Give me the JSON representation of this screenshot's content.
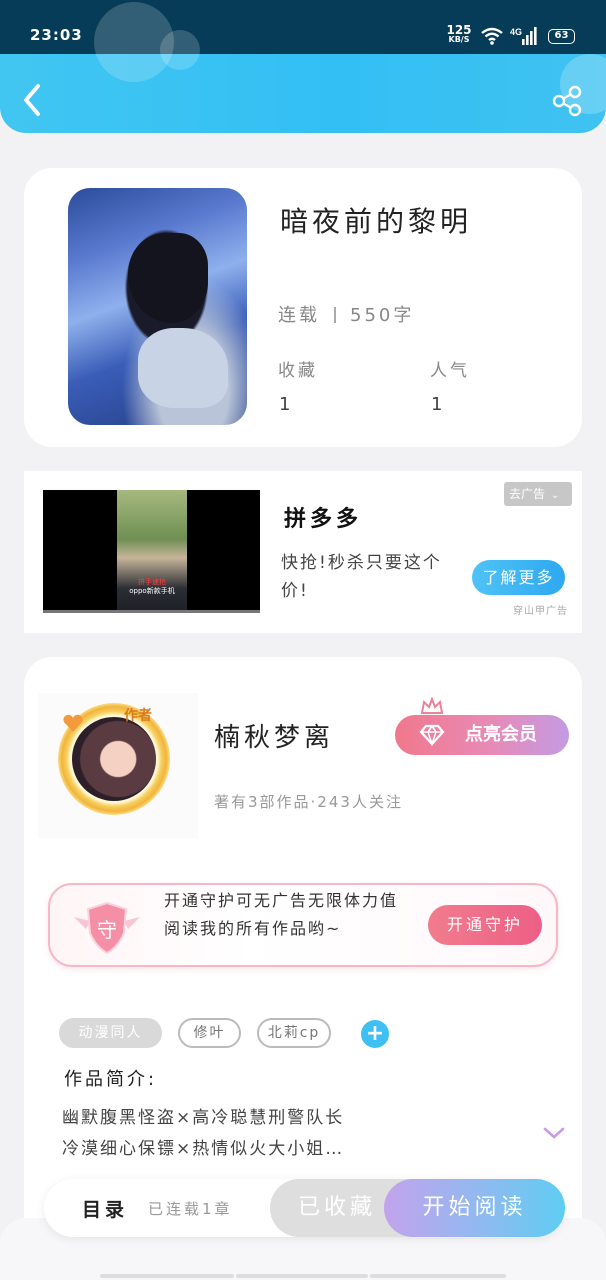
{
  "status_bar": {
    "time": "23:03",
    "net_speed": "125",
    "net_unit": "KB/S",
    "network": "4G",
    "battery": "63"
  },
  "header": {
    "back_icon": "chevron-left-icon",
    "share_icon": "share-icon"
  },
  "book": {
    "title": "暗夜前的黎明",
    "status": "连载",
    "word_count": "550字",
    "favorites_label": "收藏",
    "favorites_value": "1",
    "popularity_label": "人气",
    "popularity_value": "1"
  },
  "ad": {
    "close_label": "去广告",
    "title": "拼多多",
    "description": "快抢!秒杀只要这个价!",
    "cta": "了解更多",
    "source": "穿山甲广告",
    "video_caption_1": "拼手速抢",
    "video_caption_2": "oppo新款手机"
  },
  "author": {
    "badge": "作者",
    "name": "楠秋梦离",
    "works": "著有3部作品·243人关注",
    "vip_button": "点亮会员",
    "guard_shield_char": "守",
    "guard_text": "开通守护可无广告无限体力值阅读我的所有作品哟~",
    "guard_button": "开通守护"
  },
  "tags": [
    "动漫同人",
    "修叶",
    "北莉cp"
  ],
  "intro": {
    "label": "作品简介:",
    "text_line1": "幽默腹黑怪盗×高冷聪慧刑警队长",
    "text_line2": "冷漠细心保镖×热情似火大小姐…"
  },
  "bottom": {
    "toc_label": "目录",
    "toc_status": "已连载1章",
    "favorited": "已收藏",
    "start_reading": "开始阅读"
  },
  "colors": {
    "accent_blue": "#3ec0f2",
    "status_bar_bg": "#063c57",
    "vip_pink": "#f0788c",
    "guard_pink": "#ed5f86"
  }
}
